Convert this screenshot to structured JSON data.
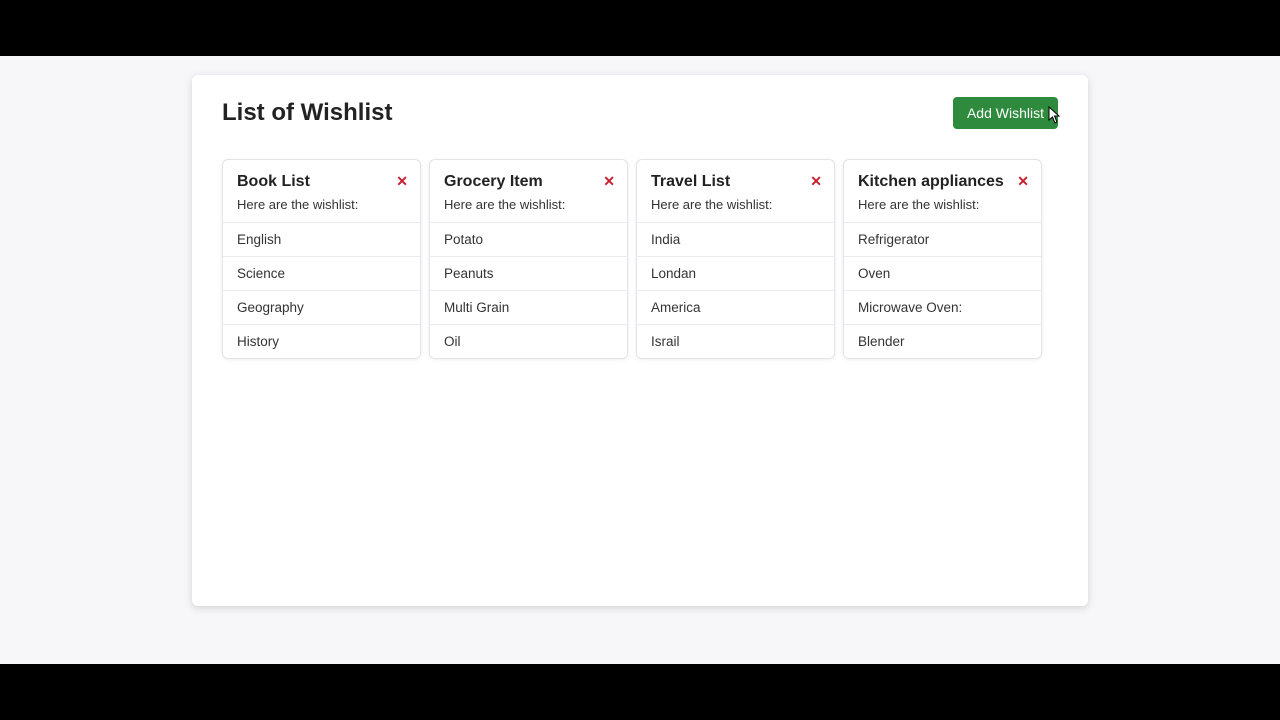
{
  "page": {
    "title": "List of Wishlist",
    "add_button": "Add Wishlist",
    "subtitle": "Here are the wishlist:"
  },
  "wishlists": [
    {
      "title": "Book List",
      "items": [
        "English",
        "Science",
        "Geography",
        "History"
      ]
    },
    {
      "title": "Grocery Item",
      "items": [
        "Potato",
        "Peanuts",
        "Multi Grain",
        "Oil"
      ]
    },
    {
      "title": "Travel List",
      "items": [
        "India",
        "Londan",
        "America",
        "Israil"
      ]
    },
    {
      "title": "Kitchen appliances",
      "items": [
        "Refrigerator",
        "Oven",
        "Microwave Oven:",
        "Blender"
      ]
    }
  ],
  "close_glyph": "✕"
}
